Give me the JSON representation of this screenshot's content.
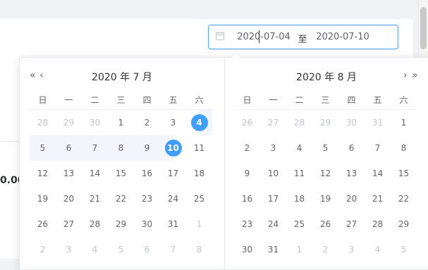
{
  "range_input": {
    "start": "2020-07-04",
    "separator": "至",
    "end": "2020-07-10"
  },
  "background": {
    "partial_value": "0.00"
  },
  "weekdays": [
    "日",
    "一",
    "二",
    "三",
    "四",
    "五",
    "六"
  ],
  "nav": {
    "prev_year": "«",
    "prev_month": "‹",
    "next_month": "›",
    "next_year": "»"
  },
  "left_panel": {
    "title": "2020 年 7 月",
    "weeks": [
      [
        {
          "d": "28",
          "t": "other"
        },
        {
          "d": "29",
          "t": "other"
        },
        {
          "d": "30",
          "t": "other"
        },
        {
          "d": "1",
          "t": "normal"
        },
        {
          "d": "2",
          "t": "normal"
        },
        {
          "d": "3",
          "t": "normal"
        },
        {
          "d": "4",
          "t": "start"
        }
      ],
      [
        {
          "d": "5",
          "t": "range"
        },
        {
          "d": "6",
          "t": "range"
        },
        {
          "d": "7",
          "t": "range"
        },
        {
          "d": "8",
          "t": "range"
        },
        {
          "d": "9",
          "t": "range"
        },
        {
          "d": "10",
          "t": "end"
        },
        {
          "d": "11",
          "t": "normal"
        }
      ],
      [
        {
          "d": "12",
          "t": "normal"
        },
        {
          "d": "13",
          "t": "normal"
        },
        {
          "d": "14",
          "t": "normal"
        },
        {
          "d": "15",
          "t": "normal"
        },
        {
          "d": "16",
          "t": "normal"
        },
        {
          "d": "17",
          "t": "normal"
        },
        {
          "d": "18",
          "t": "normal"
        }
      ],
      [
        {
          "d": "19",
          "t": "normal"
        },
        {
          "d": "20",
          "t": "normal"
        },
        {
          "d": "21",
          "t": "normal"
        },
        {
          "d": "22",
          "t": "normal"
        },
        {
          "d": "23",
          "t": "normal"
        },
        {
          "d": "24",
          "t": "normal"
        },
        {
          "d": "25",
          "t": "normal"
        }
      ],
      [
        {
          "d": "26",
          "t": "normal"
        },
        {
          "d": "27",
          "t": "normal"
        },
        {
          "d": "28",
          "t": "normal"
        },
        {
          "d": "29",
          "t": "normal"
        },
        {
          "d": "30",
          "t": "normal"
        },
        {
          "d": "31",
          "t": "normal"
        },
        {
          "d": "1",
          "t": "other"
        }
      ],
      [
        {
          "d": "2",
          "t": "other"
        },
        {
          "d": "3",
          "t": "other"
        },
        {
          "d": "4",
          "t": "other"
        },
        {
          "d": "5",
          "t": "other"
        },
        {
          "d": "6",
          "t": "other"
        },
        {
          "d": "7",
          "t": "other"
        },
        {
          "d": "8",
          "t": "other"
        }
      ]
    ]
  },
  "right_panel": {
    "title": "2020 年 8 月",
    "weeks": [
      [
        {
          "d": "26",
          "t": "other"
        },
        {
          "d": "27",
          "t": "other"
        },
        {
          "d": "28",
          "t": "other"
        },
        {
          "d": "29",
          "t": "other"
        },
        {
          "d": "30",
          "t": "other"
        },
        {
          "d": "31",
          "t": "other"
        },
        {
          "d": "1",
          "t": "normal"
        }
      ],
      [
        {
          "d": "2",
          "t": "normal"
        },
        {
          "d": "3",
          "t": "normal"
        },
        {
          "d": "4",
          "t": "normal"
        },
        {
          "d": "5",
          "t": "normal"
        },
        {
          "d": "6",
          "t": "normal"
        },
        {
          "d": "7",
          "t": "normal"
        },
        {
          "d": "8",
          "t": "normal"
        }
      ],
      [
        {
          "d": "9",
          "t": "normal"
        },
        {
          "d": "10",
          "t": "normal"
        },
        {
          "d": "11",
          "t": "normal"
        },
        {
          "d": "12",
          "t": "normal"
        },
        {
          "d": "13",
          "t": "normal"
        },
        {
          "d": "14",
          "t": "normal"
        },
        {
          "d": "15",
          "t": "normal"
        }
      ],
      [
        {
          "d": "16",
          "t": "normal"
        },
        {
          "d": "17",
          "t": "normal"
        },
        {
          "d": "18",
          "t": "normal"
        },
        {
          "d": "19",
          "t": "normal"
        },
        {
          "d": "20",
          "t": "normal"
        },
        {
          "d": "21",
          "t": "normal"
        },
        {
          "d": "22",
          "t": "normal"
        }
      ],
      [
        {
          "d": "23",
          "t": "normal"
        },
        {
          "d": "24",
          "t": "normal"
        },
        {
          "d": "25",
          "t": "normal"
        },
        {
          "d": "26",
          "t": "normal"
        },
        {
          "d": "27",
          "t": "normal"
        },
        {
          "d": "28",
          "t": "normal"
        },
        {
          "d": "29",
          "t": "normal"
        }
      ],
      [
        {
          "d": "30",
          "t": "normal"
        },
        {
          "d": "31",
          "t": "normal"
        },
        {
          "d": "1",
          "t": "other"
        },
        {
          "d": "2",
          "t": "other"
        },
        {
          "d": "3",
          "t": "other"
        },
        {
          "d": "4",
          "t": "other"
        },
        {
          "d": "5",
          "t": "other"
        }
      ]
    ]
  },
  "colors": {
    "accent": "#409eff",
    "range_bg": "#f2f6fc",
    "muted": "#c0c4cc",
    "text": "#606266"
  }
}
